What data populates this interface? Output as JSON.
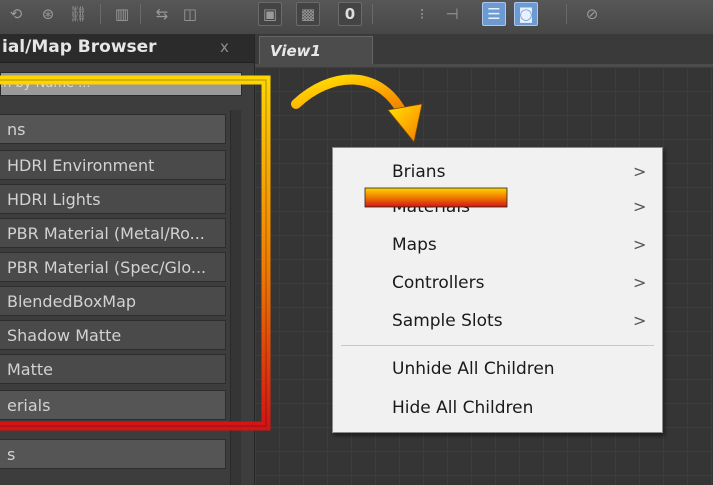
{
  "toolbar": {
    "buttons": [
      {
        "name": "rotate-icon",
        "glyph": "⟲"
      },
      {
        "name": "bind-icon",
        "glyph": "⊛"
      },
      {
        "name": "link-icon",
        "glyph": "⛓"
      },
      {
        "name": "panel-icon",
        "glyph": "▥"
      },
      {
        "name": "network-icon",
        "glyph": "⇆"
      },
      {
        "name": "frame-icon",
        "glyph": "◫"
      },
      {
        "name": "box-icon",
        "glyph": "▣"
      },
      {
        "name": "checker-icon",
        "glyph": "▩"
      },
      {
        "name": "zero-icon",
        "glyph": "0"
      },
      {
        "name": "dots-icon",
        "glyph": "⁝"
      },
      {
        "name": "tree-icon",
        "glyph": "⊣"
      },
      {
        "name": "list-view-icon",
        "glyph": "☰"
      },
      {
        "name": "material-view-icon",
        "glyph": "◙"
      },
      {
        "name": "disabled-icon",
        "glyph": "⊘"
      }
    ]
  },
  "panel": {
    "title": "ial/Map Browser",
    "close_label": "x",
    "search_text": "arch by Name ...",
    "rows": [
      {
        "label": "ns",
        "kind": "group"
      },
      {
        "label": "HDRI Environment",
        "kind": "item"
      },
      {
        "label": "HDRI Lights",
        "kind": "item"
      },
      {
        "label": "PBR Material (Metal/Ro...",
        "kind": "item"
      },
      {
        "label": "PBR Material (Spec/Glo...",
        "kind": "item"
      },
      {
        "label": "BlendedBoxMap",
        "kind": "item"
      },
      {
        "label": "Shadow Matte",
        "kind": "item"
      },
      {
        "label": "Matte",
        "kind": "item"
      },
      {
        "label": "erials",
        "kind": "group"
      },
      {
        "label": "s",
        "kind": "group"
      }
    ]
  },
  "viewport": {
    "tab_label": "View1"
  },
  "context_menu": {
    "items": [
      {
        "label": "Brians",
        "submenu": true
      },
      {
        "label": "Materials",
        "submenu": true
      },
      {
        "label": "Maps",
        "submenu": true
      },
      {
        "label": "Controllers",
        "submenu": true
      },
      {
        "label": "Sample Slots",
        "submenu": true
      },
      {
        "label": "Unhide All Children",
        "submenu": false
      },
      {
        "label": "Hide All Children",
        "submenu": false
      }
    ],
    "chevron": ">"
  },
  "annotation": {
    "colors": {
      "top": "#ffd500",
      "mid": "#f07a00",
      "bottom": "#d41414"
    }
  }
}
